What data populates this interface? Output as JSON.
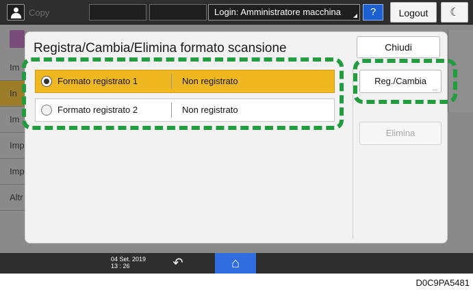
{
  "topbar": {
    "mode": "Copy",
    "login": "Login: Amministratore macchina",
    "help": "?",
    "logout": "Logout",
    "energy": "☾"
  },
  "background": {
    "items": [
      "Im",
      "In",
      "Im",
      "Imp",
      "Imp",
      "Altr"
    ]
  },
  "dialog": {
    "title": "Registra/Cambia/Elimina formato scansione",
    "close": "Chiudi",
    "reg_change": "Reg./Cambia",
    "reg_dots": "...",
    "delete": "Elimina",
    "rows": [
      {
        "name": "Formato registrato 1",
        "status": "Non registrato",
        "selected": true
      },
      {
        "name": "Formato registrato 2",
        "status": "Non registrato",
        "selected": false
      }
    ]
  },
  "bottombar": {
    "date": "04 Set. 2019",
    "time": "13 : 26",
    "back": "↶",
    "home": "⌂"
  },
  "colors": {
    "selected_row": "#f0b820",
    "callout": "#239b3f",
    "home_accent": "#2f6de0"
  },
  "caption": "D0C9PA5481"
}
